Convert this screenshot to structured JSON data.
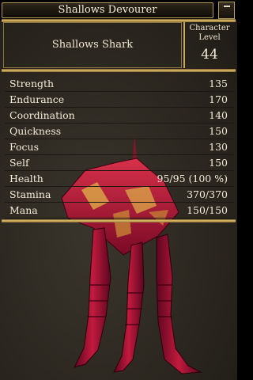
{
  "window": {
    "title": "Shallows Devourer",
    "close_icon": "minimize-icon"
  },
  "header": {
    "creature_name": "Shallows Shark",
    "level_label_line1": "Character",
    "level_label_line2": "Level",
    "level_value": "44"
  },
  "stats": [
    {
      "label": "Strength",
      "value": "135"
    },
    {
      "label": "Endurance",
      "value": "170"
    },
    {
      "label": "Coordination",
      "value": "140"
    },
    {
      "label": "Quickness",
      "value": "150"
    },
    {
      "label": "Focus",
      "value": "130"
    },
    {
      "label": "Self",
      "value": "150"
    },
    {
      "label": "Health",
      "value": "95/95 (100 %)"
    },
    {
      "label": "Stamina",
      "value": "370/370"
    },
    {
      "label": "Mana",
      "value": "150/150"
    }
  ],
  "colors": {
    "gold": "#e3c06c",
    "text": "#f3ecd8",
    "creature_red": "#a8123a"
  }
}
